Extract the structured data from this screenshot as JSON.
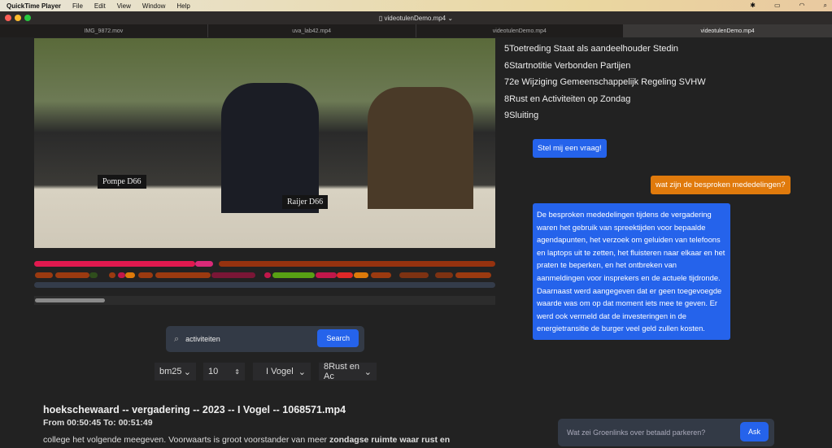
{
  "menubar": {
    "app": "QuickTime Player",
    "items": [
      "File",
      "Edit",
      "View",
      "Window",
      "Help"
    ]
  },
  "window": {
    "title": "videotulenDemo.mp4"
  },
  "tabs": [
    "IMG_9872.mov",
    "uva_lab42.mp4",
    "videotulenDemo.mp4",
    "videotulenDemo.mp4"
  ],
  "video": {
    "signs": [
      "Pompe D66",
      "Raijer D66"
    ]
  },
  "agenda": [
    "5Toetreding Staat als aandeelhouder Stedin",
    "6Startnotitie Verbonden Partijen",
    "72e Wijziging Gemeenschappelijk Regeling SVHW",
    "8Rust en Activiteiten op Zondag",
    "9Sluiting"
  ],
  "chat": {
    "prompt": "Stel mij een vraag!",
    "question": "wat zijn de besproken mededelingen?",
    "answer": "De besproken mededelingen tijdens de vergadering waren het gebruik van spreektijden voor bepaalde agendapunten, het verzoek om geluiden van telefoons en laptops uit te zetten, het fluisteren naar elkaar en het praten te beperken, en het ontbreken van aanmeldingen voor insprekers en de actuele tijdronde. Daarnaast werd aangegeven dat er geen toegevoegde waarde was om op dat moment iets mee te geven. Er werd ook vermeld dat de investeringen in de energietransitie de burger veel geld zullen kosten.",
    "ask_placeholder": "Wat zei Groenlinks over betaald parkeren?",
    "ask_label": "Ask"
  },
  "search": {
    "value": "activiteiten",
    "button": "Search"
  },
  "filters": {
    "method": "bm25",
    "count": "10",
    "speaker": "I Vogel",
    "agenda": "8Rust en Ac"
  },
  "result": {
    "title": "hoekschewaard -- vergadering -- 2023 -- I Vogel -- 1068571.mp4",
    "time": "From 00:50:45 To: 00:51:49",
    "text_plain": "college het volgende meegeven. Voorwaarts is groot voorstander van meer ",
    "text_bold": "zondagse ruimte waar rust en"
  },
  "colors": {
    "accent": "#2563eb",
    "user_bubble": "#e07a0c"
  }
}
